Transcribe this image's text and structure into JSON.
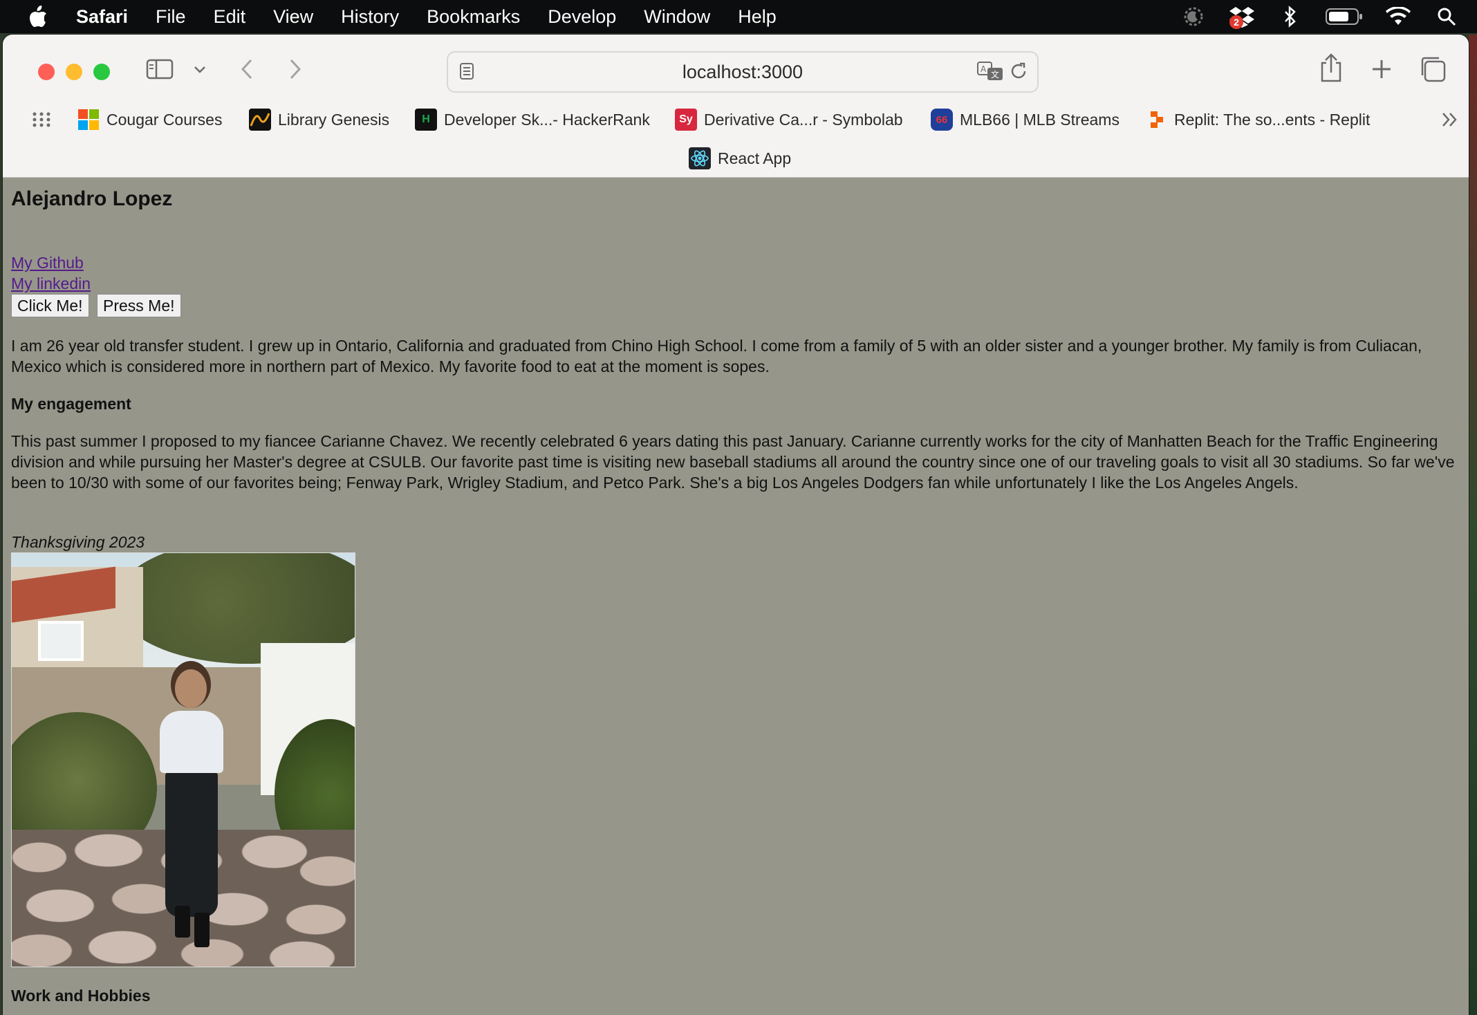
{
  "menubar": {
    "app_name": "Safari",
    "items": [
      "File",
      "Edit",
      "View",
      "History",
      "Bookmarks",
      "Develop",
      "Window",
      "Help"
    ],
    "dropbox_badge": "2"
  },
  "browser": {
    "url": "localhost:3000",
    "favorites": [
      {
        "label": "Cougar Courses",
        "icon": "microsoft-grid-icon"
      },
      {
        "label": "Library Genesis",
        "icon": "library-genesis-icon"
      },
      {
        "label": "Developer Sk...- HackerRank",
        "icon": "hackerrank-icon"
      },
      {
        "label": "Derivative Ca...r - Symbolab",
        "icon": "symbolab-icon"
      },
      {
        "label": "MLB66 | MLB Streams",
        "icon": "mlb66-icon"
      },
      {
        "label": "Replit: The so...ents - Replit",
        "icon": "replit-icon"
      }
    ],
    "favorites_row2": {
      "label": "React App",
      "icon": "react-icon"
    },
    "symbolab_icon_text": "Sy",
    "hackerrank_icon_text": "H",
    "mlb_icon_text": "66"
  },
  "page": {
    "title": "Alejandro Lopez",
    "links": {
      "github": "My Github",
      "linkedin": "My linkedin"
    },
    "buttons": {
      "click": "Click Me!",
      "press": "Press Me!"
    },
    "intro": "I am 26 year old transfer student. I grew up in Ontario, California and graduated from Chino High School. I come from a family of 5 with an older sister and a younger brother. My family is from Culiacan, Mexico which is considered more in northern part of Mexico. My favorite food to eat at the moment is sopes.",
    "engagement_heading": "My engagement",
    "engagement_text": "This past summer I proposed to my fiancee Carianne Chavez. We recently celebrated 6 years dating this past January. Carianne currently works for the city of Manhatten Beach for the Traffic Engineering division and while pursuing her Master's degree at CSULB. Our favorite past time is visiting new baseball stadiums all around the country since one of our traveling goals to visit all 30 stadiums. So far we've been to 10/30 with some of our favorites being; Fenway Park, Wrigley Stadium, and Petco Park. She's a big Los Angeles Dodgers fan while unfortunately I like the Los Angeles Angels.",
    "photo_caption": "Thanksgiving 2023",
    "work_heading": "Work and Hobbies"
  },
  "colors": {
    "page_background": "#96978a",
    "link": "#551a8b",
    "toolbar": "#f4f3f2"
  }
}
